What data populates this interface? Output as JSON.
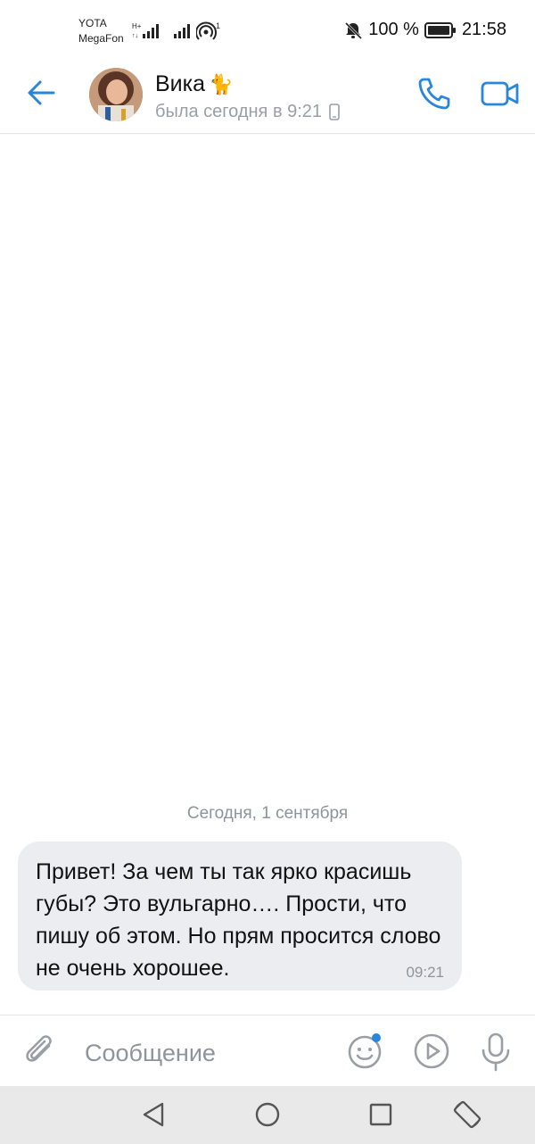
{
  "status_bar": {
    "carrier1": "YOTA",
    "carrier2": "MegaFon",
    "net1": "H+",
    "hotspot_count": "1",
    "battery": "100 %",
    "time": "21:58"
  },
  "header": {
    "contact_name": "Вика",
    "contact_emoji": "🐈",
    "last_seen": "была сегодня в 9:21"
  },
  "chat": {
    "date_separator": "Сегодня, 1 сентября",
    "messages": [
      {
        "text": "Привет! За чем ты так ярко красишь губы? Это вульгарно…. Прости, что пишу об этом. Но прям просится слово не очень хорошее.",
        "time": "09:21",
        "direction": "incoming"
      }
    ]
  },
  "composer": {
    "placeholder": "Сообщение"
  },
  "colors": {
    "accent": "#2a86d9",
    "bubble_bg": "#ebedf0",
    "muted_text": "#8e949b",
    "notification_dot": "#2a86d9"
  },
  "icons": {
    "back": "arrow-left-icon",
    "call": "phone-icon",
    "video": "video-camera-icon",
    "attach": "paperclip-icon",
    "emoji": "smile-icon",
    "play": "play-circle-icon",
    "mic": "microphone-icon",
    "nav_back": "triangle-back-icon",
    "nav_home": "circle-home-icon",
    "nav_recents": "square-recents-icon",
    "nav_rotate": "rotate-icon"
  }
}
